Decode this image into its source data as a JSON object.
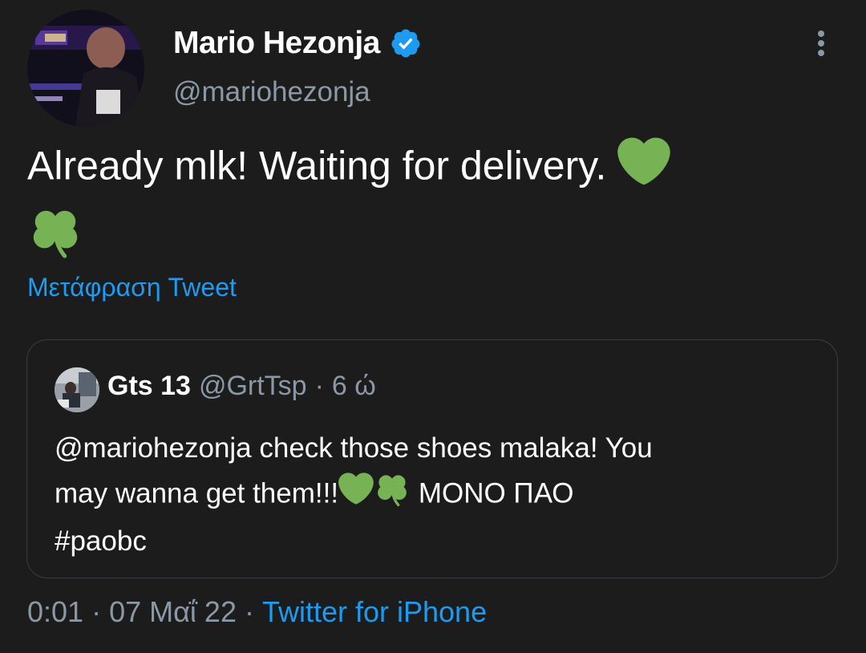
{
  "author": {
    "name": "Mario Hezonja",
    "handle": "@mariohezonja",
    "verified_icon": "verified-badge-icon",
    "verified_color": "#1d9bf0"
  },
  "menu_icon": "more-vertical-icon",
  "tweet": {
    "text": "Already mlk! Waiting for delivery.",
    "emojis": [
      "green-heart-icon",
      "shamrock-icon"
    ],
    "translate_label": "Μετάφραση Tweet"
  },
  "quote": {
    "name": "Gts 13",
    "handle": "@GrtTsp",
    "separator": "·",
    "time": "6 ώ",
    "text_line1": "@mariohezonja check those shoes malaka! You",
    "text_line2_prefix": "may wanna get them!!!",
    "text_line2_suffix": "ΜΟΝΟ ΠΑΟ",
    "text_line3": "#paobc"
  },
  "meta": {
    "time": "0:01",
    "sep1": "·",
    "date": "07 Μαΐ 22",
    "sep2": "·",
    "source": "Twitter for iPhone"
  },
  "colors": {
    "background": "#1c1c1c",
    "link": "#1d9bf0",
    "secondary_text": "#8b98a5",
    "emoji_green": "#77b255"
  }
}
